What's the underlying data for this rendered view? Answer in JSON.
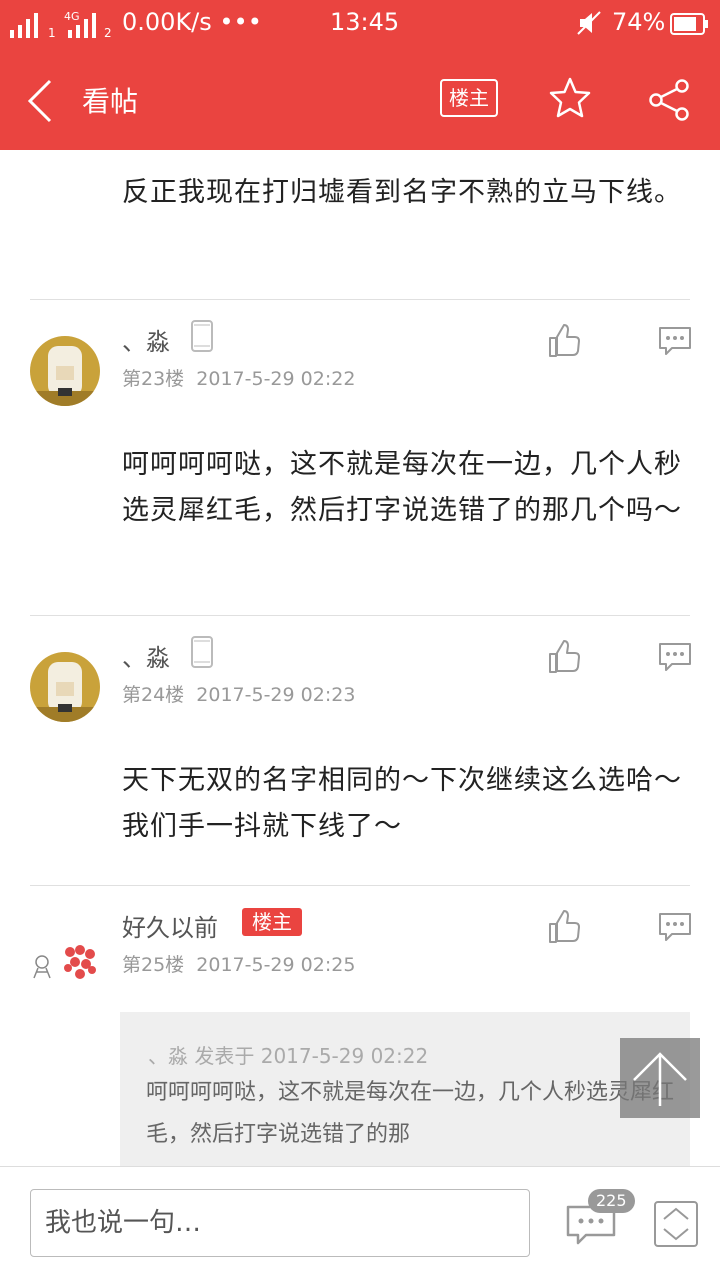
{
  "status_bar": {
    "network": "4G",
    "speed": "0.00K/s •••",
    "time": "13:45",
    "battery": "74%"
  },
  "nav": {
    "title": "看帖",
    "owner_button": "楼主"
  },
  "prev_post_text": "反正我现在打归墟看到名字不熟的立马下线。",
  "posts": [
    {
      "username": "、淼",
      "floor": "第23楼",
      "date": "2017-5-29 02:22",
      "text": "呵呵呵呵哒，这不就是每次在一边，几个人秒选灵犀红毛，然后打字说选错了的那几个吗～"
    },
    {
      "username": "、淼",
      "floor": "第24楼",
      "date": "2017-5-29 02:23",
      "text": "天下无双的名字相同的～下次继续这么选哈～我们手一抖就下线了～"
    },
    {
      "username": "好久以前",
      "badge": "楼主",
      "floor": "第25楼",
      "date": "2017-5-29 02:25",
      "quote_header": "、淼 发表于 2017-5-29 02:22",
      "quote_text": "呵呵呵呵哒，这不就是每次在一边，几个人秒选灵犀红毛，然后打字说选错了的那"
    }
  ],
  "bottom_bar": {
    "input_placeholder": "我也说一句…",
    "comment_count": "225"
  },
  "colors": {
    "header": "#ea4440",
    "badge": "#ea4440"
  }
}
